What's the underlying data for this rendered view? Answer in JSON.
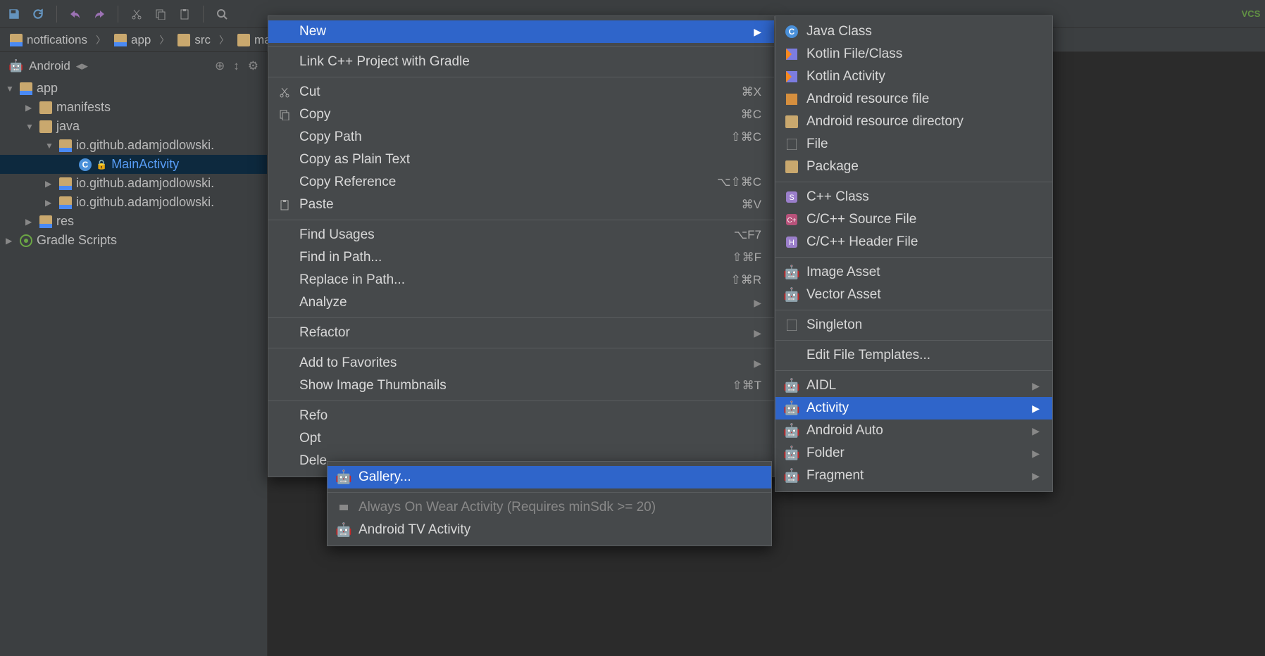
{
  "breadcrumb": [
    "notfications",
    "app",
    "src",
    "mai"
  ],
  "sidebar_view": "Android",
  "tree": {
    "app": "app",
    "manifests": "manifests",
    "java": "java",
    "pkg1": "io.github.adamjodlowski.",
    "main_activity": "MainActivity",
    "pkg2": "io.github.adamjodlowski.",
    "pkg3": "io.github.adamjodlowski.",
    "res": "res",
    "gradle": "Gradle Scripts"
  },
  "context_menu": {
    "new": "New",
    "link_cpp": "Link C++ Project with Gradle",
    "cut": "Cut",
    "cut_sc": "⌘X",
    "copy": "Copy",
    "copy_sc": "⌘C",
    "copy_path": "Copy Path",
    "copy_path_sc": "⇧⌘C",
    "copy_plain": "Copy as Plain Text",
    "copy_ref": "Copy Reference",
    "copy_ref_sc": "⌥⇧⌘C",
    "paste": "Paste",
    "paste_sc": "⌘V",
    "find_usages": "Find Usages",
    "find_usages_sc": "⌥F7",
    "find_path": "Find in Path...",
    "find_path_sc": "⇧⌘F",
    "replace_path": "Replace in Path...",
    "replace_path_sc": "⇧⌘R",
    "analyze": "Analyze",
    "refactor": "Refactor",
    "add_fav": "Add to Favorites",
    "show_thumb": "Show Image Thumbnails",
    "show_thumb_sc": "⇧⌘T",
    "refo": "Refo",
    "opt": "Opt",
    "dele": "Dele"
  },
  "submenu_new": {
    "java_class": "Java Class",
    "kotlin_file": "Kotlin File/Class",
    "kotlin_activity": "Kotlin Activity",
    "android_res_file": "Android resource file",
    "android_res_dir": "Android resource directory",
    "file": "File",
    "package": "Package",
    "cpp_class": "C++ Class",
    "c_source": "C/C++ Source File",
    "c_header": "C/C++ Header File",
    "image_asset": "Image Asset",
    "vector_asset": "Vector Asset",
    "singleton": "Singleton",
    "edit_templates": "Edit File Templates...",
    "aidl": "AIDL",
    "activity": "Activity",
    "android_auto": "Android Auto",
    "folder": "Folder",
    "fragment": "Fragment"
  },
  "submenu_activity": {
    "gallery": "Gallery...",
    "wear": "Always On Wear Activity (Requires minSdk >= 20)",
    "tv": "Android TV Activity"
  }
}
